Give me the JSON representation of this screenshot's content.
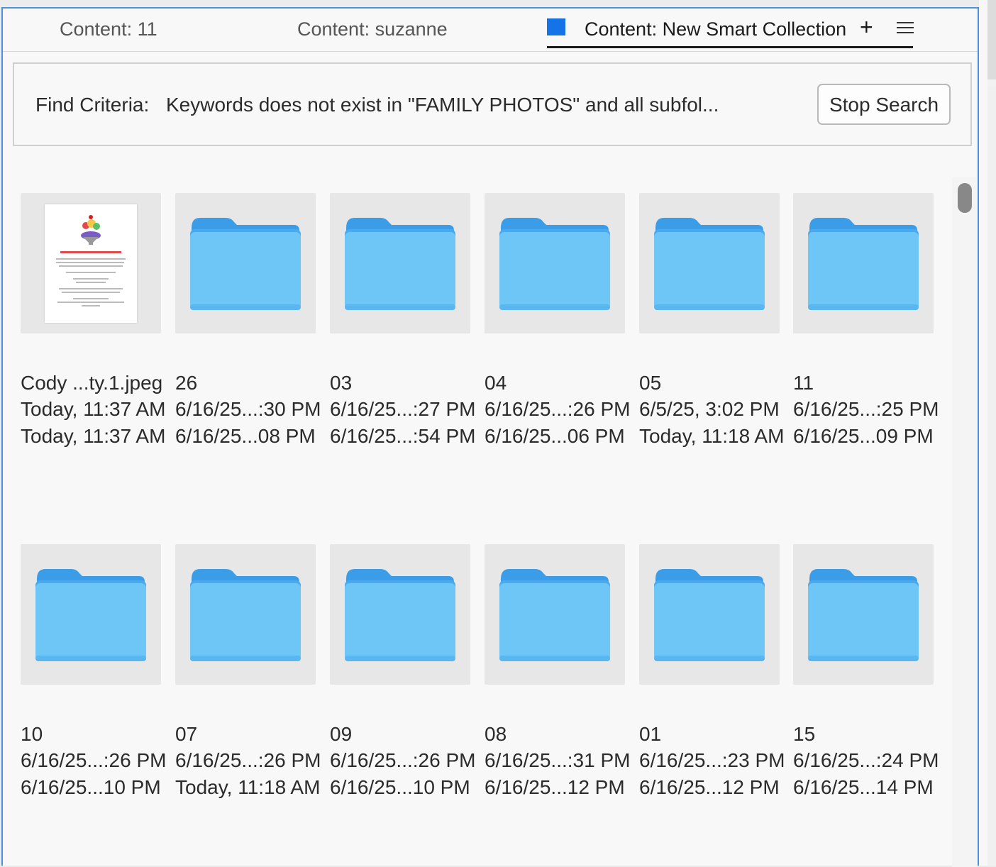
{
  "tabs": [
    {
      "label": "Content: 11",
      "active": false
    },
    {
      "label": "Content: suzanne",
      "active": false
    },
    {
      "label": "Content: New Smart Collection",
      "active": true
    }
  ],
  "tab_color": "#1473e6",
  "accent_border": "#4a8fe0",
  "add_tab_label": "+",
  "menu_icon": "hamburger-icon",
  "find": {
    "label": "Find Criteria:",
    "criteria": "Keywords does not exist in \"FAMILY PHOTOS\" and all subfol...",
    "stop_label": "Stop Search"
  },
  "folder_color": "#6ec6f6",
  "items": [
    {
      "name": "Cody ...ty.1.jpeg",
      "date1": "Today, 11:37 AM",
      "date2": "Today, 11:37 AM",
      "kind": "image"
    },
    {
      "name": "26",
      "date1": "6/16/25...:30 PM",
      "date2": "6/16/25...08 PM",
      "kind": "folder"
    },
    {
      "name": "03",
      "date1": "6/16/25...:27 PM",
      "date2": "6/16/25...:54 PM",
      "kind": "folder"
    },
    {
      "name": "04",
      "date1": "6/16/25...:26 PM",
      "date2": "6/16/25...06 PM",
      "kind": "folder"
    },
    {
      "name": "05",
      "date1": "6/5/25, 3:02 PM",
      "date2": "Today, 11:18 AM",
      "kind": "folder"
    },
    {
      "name": "11",
      "date1": "6/16/25...:25 PM",
      "date2": "6/16/25...09 PM",
      "kind": "folder"
    },
    {
      "name": "10",
      "date1": "6/16/25...:26 PM",
      "date2": "6/16/25...10 PM",
      "kind": "folder"
    },
    {
      "name": "07",
      "date1": "6/16/25...:26 PM",
      "date2": "Today, 11:18 AM",
      "kind": "folder"
    },
    {
      "name": "09",
      "date1": "6/16/25...:26 PM",
      "date2": "6/16/25...10 PM",
      "kind": "folder"
    },
    {
      "name": "08",
      "date1": "6/16/25...:31 PM",
      "date2": "6/16/25...12 PM",
      "kind": "folder"
    },
    {
      "name": "01",
      "date1": "6/16/25...:23 PM",
      "date2": "6/16/25...12 PM",
      "kind": "folder"
    },
    {
      "name": "15",
      "date1": "6/16/25...:24 PM",
      "date2": "6/16/25...14 PM",
      "kind": "folder"
    }
  ]
}
